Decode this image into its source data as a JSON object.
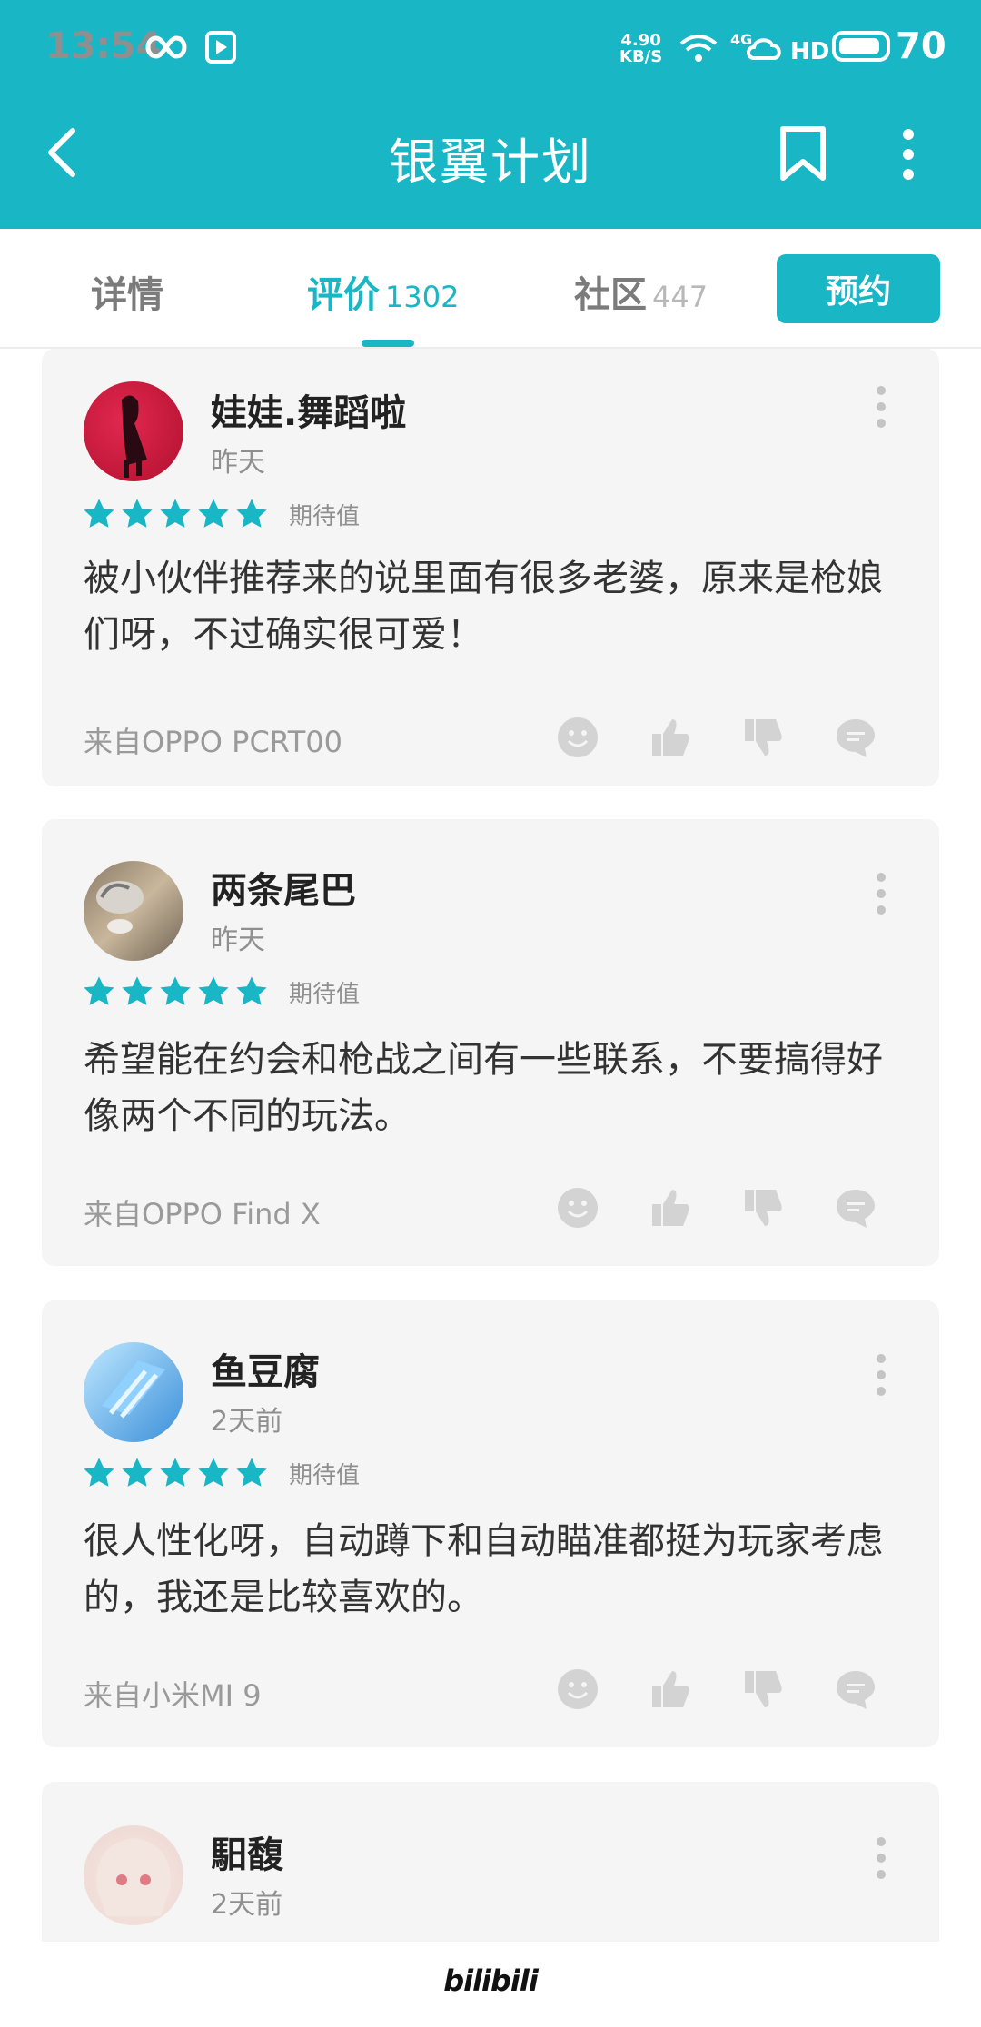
{
  "status_bar": {
    "time": "13:54",
    "net_speed_top": "4.90",
    "net_speed_bottom": "KB/S",
    "signal": "4G",
    "hd": "HD",
    "battery": "70"
  },
  "appbar": {
    "title": "银翼计划"
  },
  "tabs": [
    {
      "label": "详情",
      "count": ""
    },
    {
      "label": "评价",
      "count": "1302"
    },
    {
      "label": "社区",
      "count": "447"
    }
  ],
  "reserve_label": "预约",
  "reviews": [
    {
      "name": "娃娃.舞蹈啦",
      "time": "昨天",
      "rating_label": "期待值",
      "text": "被小伙伴推荐来的说里面有很多老婆，原来是枪娘们呀，不过确实很可爱！",
      "device": "来自OPPO PCRT00"
    },
    {
      "name": "两条尾巴",
      "time": "昨天",
      "rating_label": "期待值",
      "text": "希望能在约会和枪战之间有一些联系，不要搞得好像两个不同的玩法。",
      "device": "来自OPPO Find X"
    },
    {
      "name": "鱼豆腐",
      "time": "2天前",
      "rating_label": "期待值",
      "text": "很人性化呀，自动蹲下和自动瞄准都挺为玩家考虑的，我还是比较喜欢的。",
      "device": "来自小米MI 9"
    },
    {
      "name": "馹馥",
      "time": "2天前",
      "rating_label": "",
      "text": "",
      "device": ""
    }
  ],
  "footer": {
    "logo": "bilibili"
  },
  "colors": {
    "accent": "#19b6c6",
    "card_bg": "#f5f5f5",
    "star": "#19b6c6",
    "icon_gray": "#d3d3d3"
  }
}
